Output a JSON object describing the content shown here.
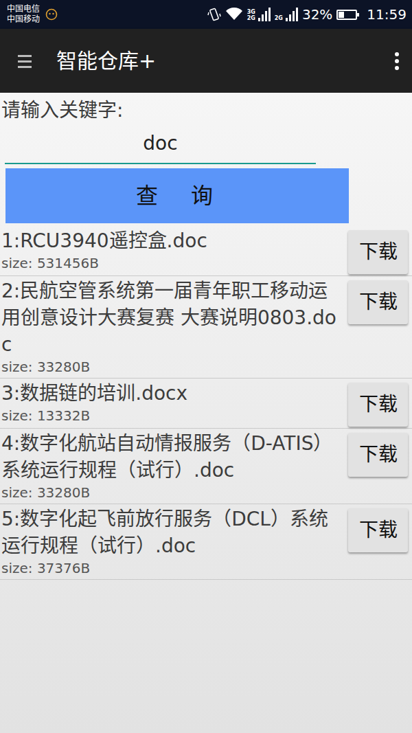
{
  "status_bar": {
    "carriers": [
      "中国电信",
      "中国移动"
    ],
    "networks": [
      {
        "labels": [
          "3G",
          "2G"
        ],
        "level": 1
      },
      {
        "labels": [
          "2G"
        ],
        "level": 1
      }
    ],
    "battery": {
      "reading": "32%",
      "level": 0.32
    },
    "time": "11:59"
  },
  "app_bar": {
    "title": "智能仓库+"
  },
  "search": {
    "label": "请输入关键字:",
    "value": "doc",
    "button": "查　询"
  },
  "results": [
    {
      "title": "1:RCU3940遥控盒.doc",
      "size": "size: 531456B",
      "button": "下载"
    },
    {
      "title": "2:民航空管系统第一届青年职工移动运用创意设计大赛复赛 大赛说明0803.doc",
      "size": "size: 33280B",
      "button": "下载"
    },
    {
      "title": "3:数据链的培训.docx",
      "size": "size: 13332B",
      "button": "下载"
    },
    {
      "title": "4:数字化航站自动情报服务（D-ATIS）系统运行规程（试行）.doc",
      "size": "size: 33280B",
      "button": "下载"
    },
    {
      "title": "5:数字化起飞前放行服务（DCL）系统运行规程（试行）.doc",
      "size": "size: 37376B",
      "button": "下载"
    }
  ]
}
